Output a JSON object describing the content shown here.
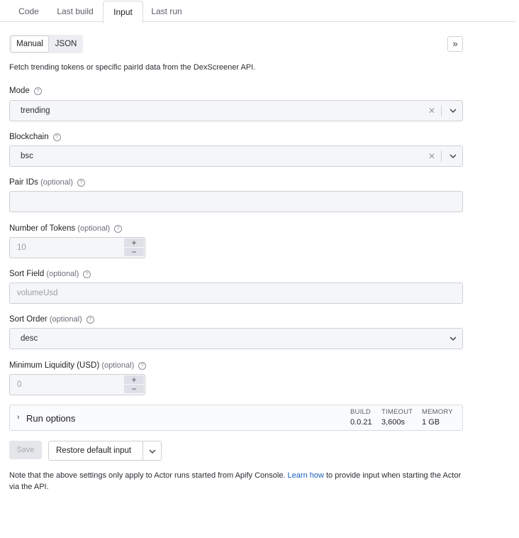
{
  "tabs": [
    {
      "label": "Code",
      "active": false
    },
    {
      "label": "Last build",
      "active": false
    },
    {
      "label": "Input",
      "active": true
    },
    {
      "label": "Last run",
      "active": false
    }
  ],
  "mode_toggle": {
    "manual": "Manual",
    "json": "JSON",
    "selected": "Manual"
  },
  "expand_icon": "double-chevron-right-icon",
  "description": "Fetch trending tokens or specific pairId data from the DexScreener API.",
  "fields": {
    "mode": {
      "label": "Mode",
      "value": "trending"
    },
    "blockchain": {
      "label": "Blockchain",
      "value": "bsc"
    },
    "pair_ids": {
      "label": "Pair IDs",
      "optional": "(optional)",
      "value": ""
    },
    "num_tokens": {
      "label": "Number of Tokens",
      "optional": "(optional)",
      "placeholder": "10"
    },
    "sort_field": {
      "label": "Sort Field",
      "optional": "(optional)",
      "placeholder": "volumeUsd"
    },
    "sort_order": {
      "label": "Sort Order",
      "optional": "(optional)",
      "value": "desc"
    },
    "min_liquidity": {
      "label": "Minimum Liquidity (USD)",
      "optional": "(optional)",
      "placeholder": "0"
    }
  },
  "run_options": {
    "title": "Run options",
    "build_label": "BUILD",
    "build_value": "0.0.21",
    "timeout_label": "TIMEOUT",
    "timeout_value": "3,600s",
    "memory_label": "MEMORY",
    "memory_value": "1 GB"
  },
  "actions": {
    "save": "Save",
    "restore": "Restore default input"
  },
  "note": {
    "before": "Note that the above settings only apply to Actor runs started from Apify Console. ",
    "link": "Learn how",
    "after": " to provide input when starting the Actor via the API."
  },
  "colors": {
    "link": "#1b5fb8",
    "border": "#cdd0d6",
    "field_bg": "#f5f6f8"
  }
}
